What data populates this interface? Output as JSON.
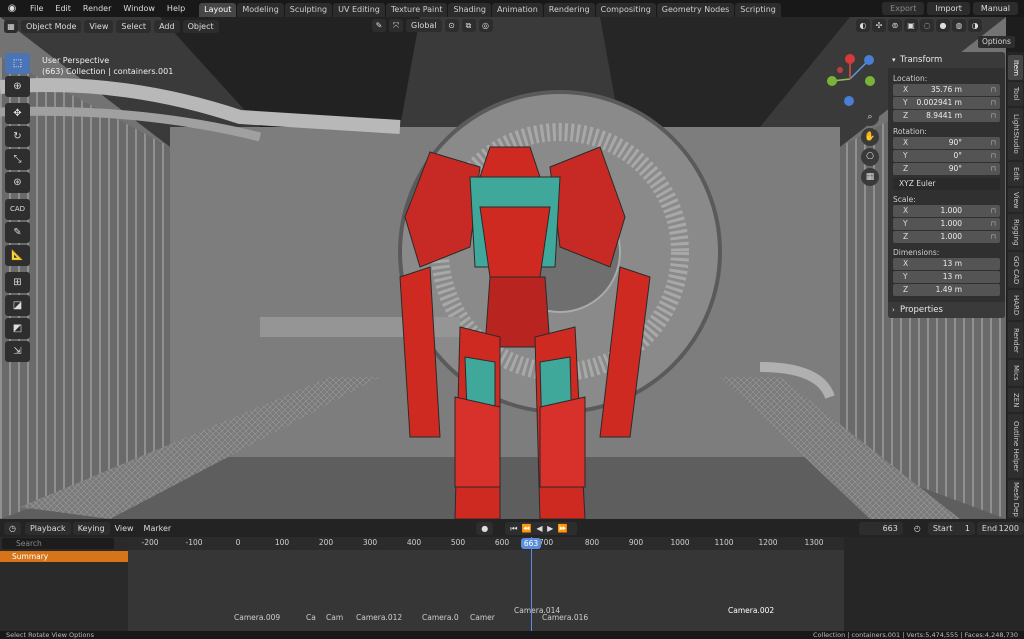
{
  "menubar": {
    "menus": [
      "File",
      "Edit",
      "Render",
      "Window",
      "Help"
    ],
    "tabs": [
      "Layout",
      "Modeling",
      "Sculpting",
      "UV Editing",
      "Texture Paint",
      "Shading",
      "Animation",
      "Rendering",
      "Compositing",
      "Geometry Nodes",
      "Scripting"
    ],
    "active_tab": "Layout",
    "right_buttons": [
      "Export",
      "Import",
      "Manual"
    ]
  },
  "viewport_header": {
    "mode": "Object Mode",
    "menus": [
      "View",
      "Select",
      "Add",
      "Object"
    ],
    "transform_orientation": "Global",
    "options": "Options"
  },
  "viewport": {
    "perspective": "User Perspective",
    "collection_info": "(663) Collection | containers.001"
  },
  "toolbar": {
    "tools": [
      "select-box",
      "cursor",
      "move",
      "rotate",
      "scale",
      "transform",
      "CAD",
      "annotate",
      "measure",
      "add-cube",
      "extrude",
      "bevel",
      "transform-tool"
    ]
  },
  "npanel": {
    "header": "Transform",
    "location_label": "Location:",
    "location": [
      {
        "ax": "X",
        "val": "35.76 m"
      },
      {
        "ax": "Y",
        "val": "0.002941 m"
      },
      {
        "ax": "Z",
        "val": "8.9441 m"
      }
    ],
    "rotation_label": "Rotation:",
    "rotation": [
      {
        "ax": "X",
        "val": "90°"
      },
      {
        "ax": "Y",
        "val": "0°"
      },
      {
        "ax": "Z",
        "val": "90°"
      }
    ],
    "rotation_mode": "XYZ Euler",
    "scale_label": "Scale:",
    "scale": [
      {
        "ax": "X",
        "val": "1.000"
      },
      {
        "ax": "Y",
        "val": "1.000"
      },
      {
        "ax": "Z",
        "val": "1.000"
      }
    ],
    "dimensions_label": "Dimensions:",
    "dimensions": [
      {
        "ax": "X",
        "val": "13 m"
      },
      {
        "ax": "Y",
        "val": "13 m"
      },
      {
        "ax": "Z",
        "val": "1.49 m"
      }
    ],
    "properties": "Properties"
  },
  "sidetabs": [
    "Item",
    "Tool",
    "LightStudio",
    "Edit",
    "View",
    "Rigging",
    "GO CAD",
    "HARD",
    "Render",
    "Mics",
    "ZEN",
    "Outline Helper",
    "Mesh Dep"
  ],
  "timeline": {
    "menus": [
      "Playback",
      "Keying",
      "View",
      "Marker"
    ],
    "current_frame": "663",
    "start_label": "Start",
    "start": "1",
    "end_label": "End",
    "end": "1200",
    "search_placeholder": "Search",
    "summary": "Summary",
    "ticks": [
      "-200",
      "-100",
      "0",
      "100",
      "200",
      "300",
      "400",
      "500",
      "600",
      "700",
      "800",
      "900",
      "1000",
      "1100",
      "1200",
      "1300"
    ],
    "markers": [
      "Camera.009",
      "Ca",
      "Cam",
      "Camera.012",
      "Camera.0",
      "Camer",
      "Camera.014",
      "Camera.016",
      "Camera.002"
    ]
  },
  "statusbar": {
    "left": "Select    Rotate View    Options",
    "right": "Collection | containers.001 | Verts:5,474,555 | Faces:4,248,730"
  },
  "colors": {
    "accent": "#4a74b6",
    "summary": "#d6741a",
    "playhead": "#5a8ddb"
  }
}
